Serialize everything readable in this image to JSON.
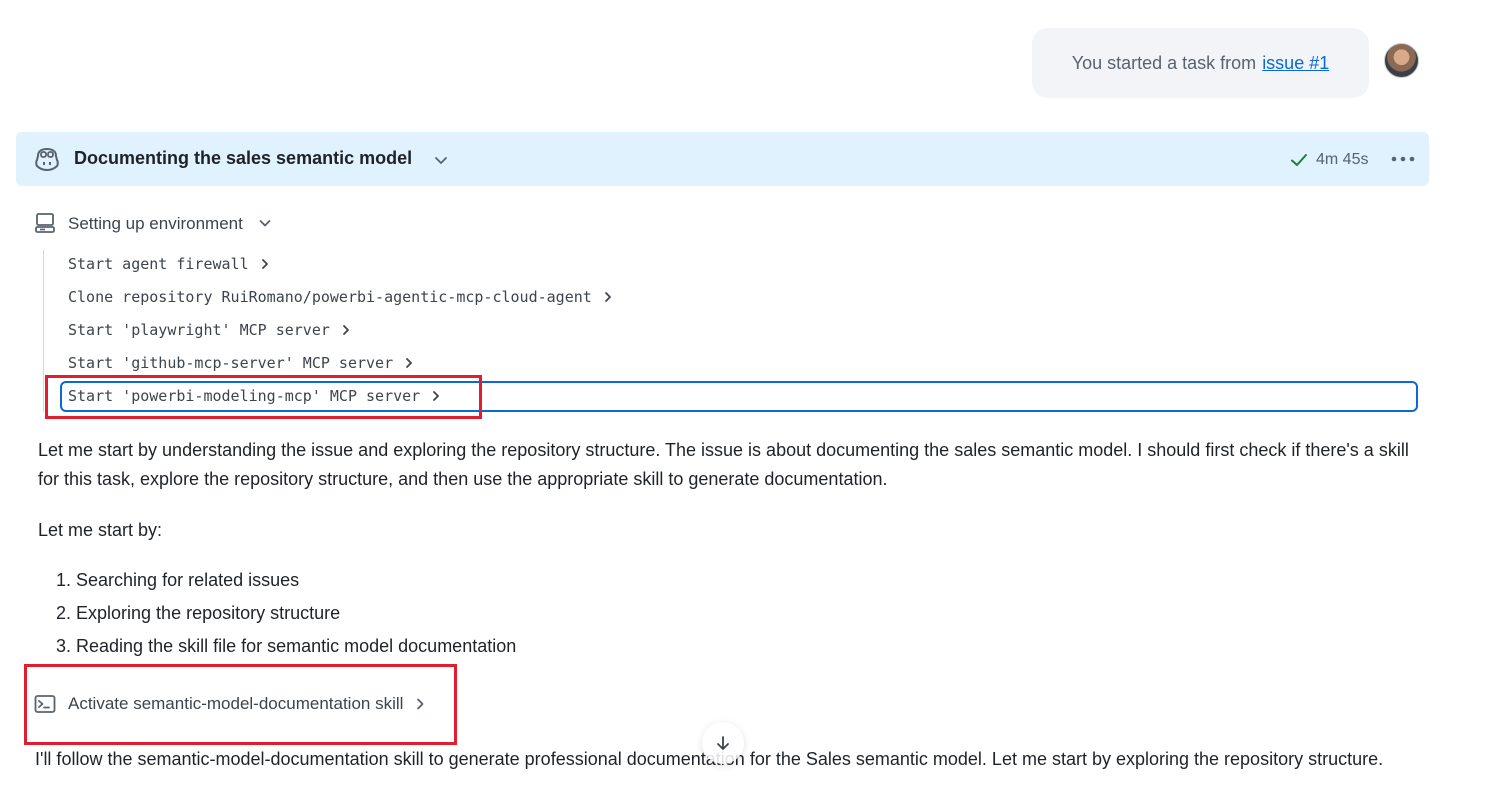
{
  "user_message": {
    "text": "You started a task from",
    "link_text": "issue #1"
  },
  "session": {
    "title": "Documenting the sales semantic model",
    "duration": "4m 45s",
    "status": "completed"
  },
  "setup": {
    "label": "Setting up environment",
    "steps": [
      "Start agent firewall",
      "Clone repository RuiRomano/powerbi-agentic-mcp-cloud-agent",
      "Start 'playwright' MCP server",
      "Start 'github-mcp-server' MCP server",
      "Start 'powerbi-modeling-mcp' MCP server"
    ]
  },
  "content": {
    "paragraph1": "Let me start by understanding the issue and exploring the repository structure. The issue is about documenting the sales semantic model. I should first check if there's a skill for this task, explore the repository structure, and then use the appropriate skill to generate documentation.",
    "paragraph2": "Let me start by:",
    "list": [
      "1. Searching for related issues",
      "2. Exploring the repository structure",
      "3. Reading the skill file for semantic model documentation"
    ],
    "skill_action": "Activate semantic-model-documentation skill",
    "paragraph3": "I'll follow the semantic-model-documentation skill to generate professional documentation for the Sales semantic model. Let me start by exploring the repository structure."
  },
  "colors": {
    "header_bg": "#dff2fd",
    "link": "#0969da",
    "highlight_red": "#e01e2d",
    "success_green": "#1a7f37"
  },
  "icons": [
    "copilot-icon",
    "chevron-down-icon",
    "check-icon",
    "kebab-menu-icon",
    "server-icon",
    "chevron-right-icon",
    "terminal-icon",
    "arrow-down-icon"
  ]
}
